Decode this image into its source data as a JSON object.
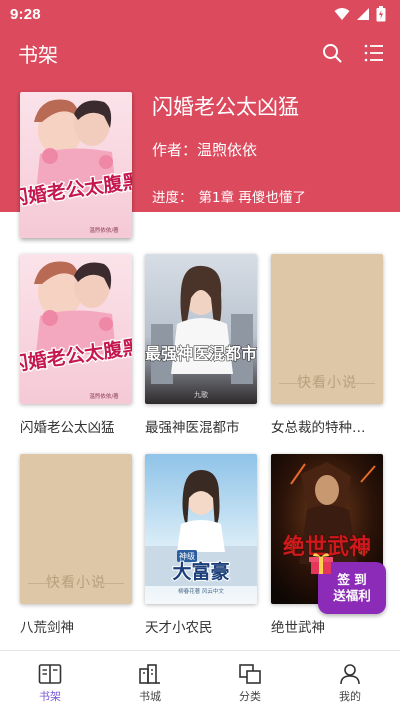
{
  "status_bar": {
    "time": "9:28"
  },
  "app_bar": {
    "title": "书架"
  },
  "current_book": {
    "title": "闪婚老公太凶猛",
    "author_label": "作者：",
    "author": "温煦依依",
    "progress_label": "进度：",
    "progress_chapter": "第1章 再傻也懂了",
    "cover_text": "闪婚老公太腹黑",
    "cover_author": "温煦依依/著"
  },
  "books": [
    {
      "name": "闪婚老公太凶猛",
      "cover_text": "闪婚老公太腹黑",
      "cover_author": "温煦依依/著"
    },
    {
      "name": "最强神医混都市",
      "cover_text": "最强神医混都市",
      "cover_author": "九歌"
    },
    {
      "name": "女总裁的特种…",
      "cover_text": "快看小说"
    },
    {
      "name": "八荒剑神",
      "cover_text": "快看小说"
    },
    {
      "name": "天才小农民",
      "cover_text": "大富豪",
      "cover_tag": "神级",
      "cover_author": "柳春花著 风云中文"
    },
    {
      "name": "绝世武神",
      "cover_text": "绝世武神"
    }
  ],
  "checkin": {
    "line1": "签 到",
    "line2": "送福利"
  },
  "bottom_nav": [
    {
      "label": "书架",
      "icon": "bookshelf-icon",
      "active": true
    },
    {
      "label": "书城",
      "icon": "bookstore-icon",
      "active": false
    },
    {
      "label": "分类",
      "icon": "category-icon",
      "active": false
    },
    {
      "label": "我的",
      "icon": "profile-icon",
      "active": false
    }
  ],
  "colors": {
    "primary": "#dc4a5e",
    "active_nav": "#7b5ad8",
    "placeholder": "#ddc7a7",
    "checkin": "#8b2bb8"
  }
}
